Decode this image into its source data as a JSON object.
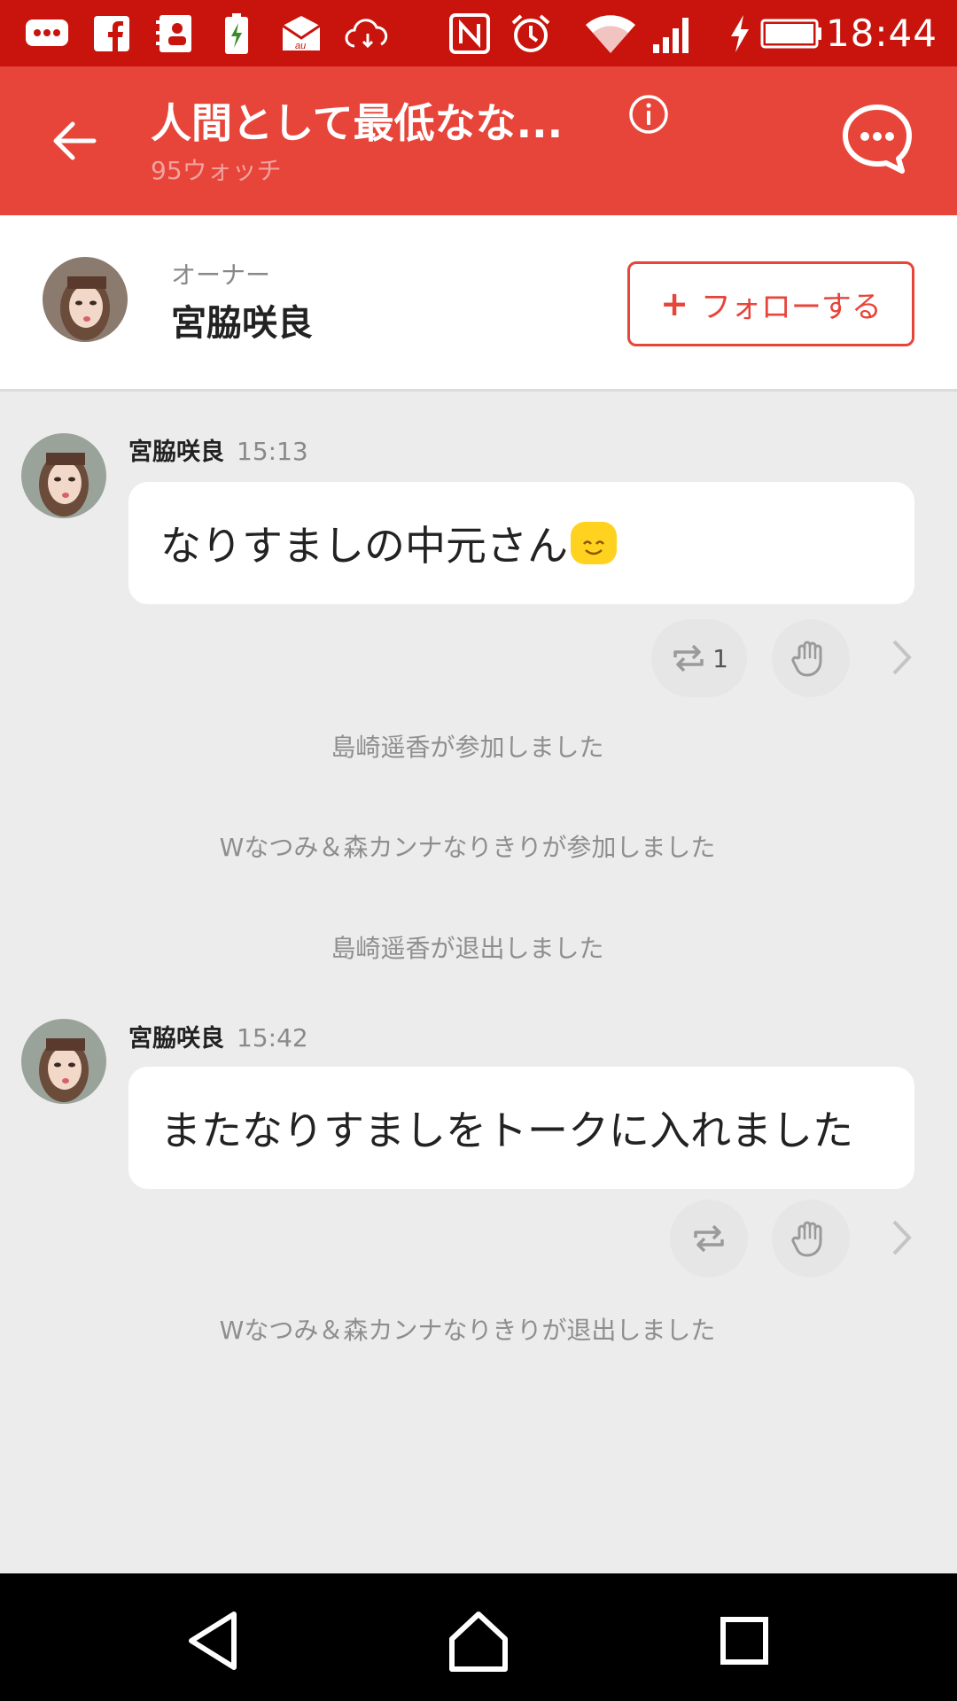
{
  "status_bar": {
    "time": "18:44",
    "icons": [
      "message-icon",
      "facebook-icon",
      "contacts-icon",
      "battery-saver-icon",
      "au-mail-icon",
      "cloud-icon",
      "nfc-icon",
      "alarm-icon",
      "wifi-icon",
      "signal-icon",
      "charging-icon",
      "battery-icon"
    ]
  },
  "app_bar": {
    "title": "人間として最低なな...",
    "subtitle": "95ウォッチ"
  },
  "owner": {
    "label": "オーナー",
    "name": "宮脇咲良",
    "follow_plus": "+",
    "follow_label": "フォローする"
  },
  "messages": [
    {
      "sender": "宮脇咲良",
      "time": "15:13",
      "text": "なりすましの中元さん",
      "emoji": "smile-emoji",
      "repost_count": "1"
    },
    {
      "sender": "宮脇咲良",
      "time": "15:42",
      "text": "またなりすましをトークに入れました"
    }
  ],
  "system_messages": [
    "島崎遥香が参加しました",
    "Wなつみ＆森カンナなりきりが参加しました",
    "島崎遥香が退出しました",
    "Wなつみ＆森カンナなりきりが退出しました"
  ],
  "colors": {
    "status_bar": "#c8140c",
    "app_bar": "#e7443a",
    "accent": "#e7443a",
    "background": "#ececec"
  }
}
